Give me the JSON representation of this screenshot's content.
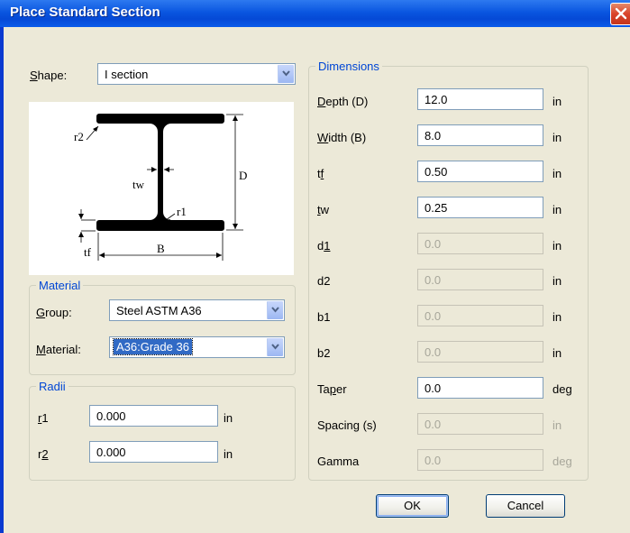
{
  "window": {
    "title": "Place Standard Section"
  },
  "shape": {
    "label": "Shape:",
    "value": "I section"
  },
  "diagram": {
    "labels": {
      "r2": "r2",
      "tw": "tw",
      "r1": "r1",
      "D": "D",
      "B": "B",
      "tf": "tf"
    }
  },
  "material": {
    "group_title": "Material",
    "group_label": "Group:",
    "group_value": "Steel ASTM A36",
    "material_label": "Material:",
    "material_value": "A36:Grade 36"
  },
  "radii": {
    "group_title": "Radii",
    "rows": [
      {
        "label": "r1",
        "value": "0.000",
        "unit": "in"
      },
      {
        "label": "r2",
        "value": "0.000",
        "unit": "in"
      }
    ]
  },
  "dimensions": {
    "group_title": "Dimensions",
    "rows": [
      {
        "label": "Depth (D)",
        "value": "12.0",
        "unit": "in",
        "enabled": true
      },
      {
        "label": "Width (B)",
        "value": "8.0",
        "unit": "in",
        "enabled": true
      },
      {
        "label": "tf",
        "value": "0.50",
        "unit": "in",
        "enabled": true
      },
      {
        "label": "tw",
        "value": "0.25",
        "unit": "in",
        "enabled": true
      },
      {
        "label": "d1",
        "value": "0.0",
        "unit": "in",
        "enabled": false
      },
      {
        "label": "d2",
        "value": "0.0",
        "unit": "in",
        "enabled": false
      },
      {
        "label": "b1",
        "value": "0.0",
        "unit": "in",
        "enabled": false
      },
      {
        "label": "b2",
        "value": "0.0",
        "unit": "in",
        "enabled": false
      },
      {
        "label": "Taper",
        "value": "0.0",
        "unit": "deg",
        "enabled": true
      },
      {
        "label": "Spacing (s)",
        "value": "0.0",
        "unit": "in",
        "enabled": false
      },
      {
        "label": "Gamma",
        "value": "0.0",
        "unit": "deg",
        "enabled": false
      }
    ]
  },
  "buttons": {
    "ok": "OK",
    "cancel": "Cancel"
  },
  "colors": {
    "title_bar": "#0a56e0",
    "dialog_bg": "#ece9d8",
    "group_title": "#0046d5",
    "close_button": "#d9442b"
  }
}
